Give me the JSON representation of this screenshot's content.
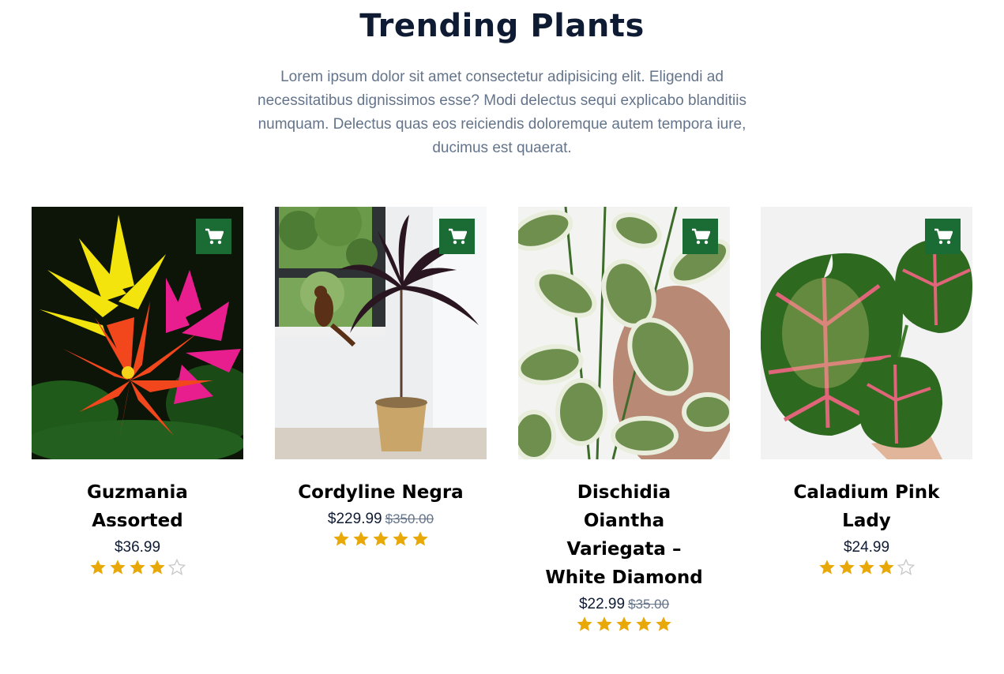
{
  "section": {
    "title": "Trending Plants",
    "intro": "Lorem ipsum dolor sit amet consectetur adipisicing elit. Eligendi ad necessitatibus dignissimos esse? Modi delectus sequi explicabo blanditiis numquam. Delectus quas eos reiciendis doloremque autem tempora iure, ducimus est quaerat."
  },
  "colors": {
    "accent": "#1b6b35",
    "star": "#e8a908",
    "title": "#0f1b33",
    "muted": "#64748b"
  },
  "products": [
    {
      "name": "Guzmania Assorted",
      "price": "$36.99",
      "old_price": "",
      "rating": 4,
      "max_rating": 5,
      "cart_icon": "cart-icon"
    },
    {
      "name": "Cordyline Negra",
      "price": "$229.99",
      "old_price": "$350.00",
      "rating": 5,
      "max_rating": 5,
      "cart_icon": "cart-icon"
    },
    {
      "name": "Dischidia Oiantha Variegata – White Diamond",
      "price": "$22.99",
      "old_price": "$35.00",
      "rating": 5,
      "max_rating": 5,
      "cart_icon": "cart-icon"
    },
    {
      "name": "Caladium Pink Lady",
      "price": "$24.99",
      "old_price": "",
      "rating": 4,
      "max_rating": 5,
      "cart_icon": "cart-icon"
    }
  ]
}
